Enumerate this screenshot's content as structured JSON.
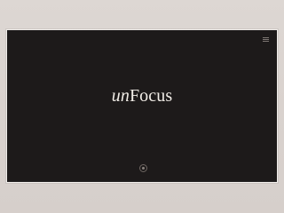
{
  "app": {
    "title_prefix": "un",
    "title_suffix": "Focus"
  },
  "controls": {
    "menu_icon": "menu-icon",
    "focus_icon": "focus-icon"
  },
  "colors": {
    "background": "#ddd7d3",
    "window": "#1d1a1a",
    "title": "#f1ede7",
    "icon": "#7d7672"
  }
}
